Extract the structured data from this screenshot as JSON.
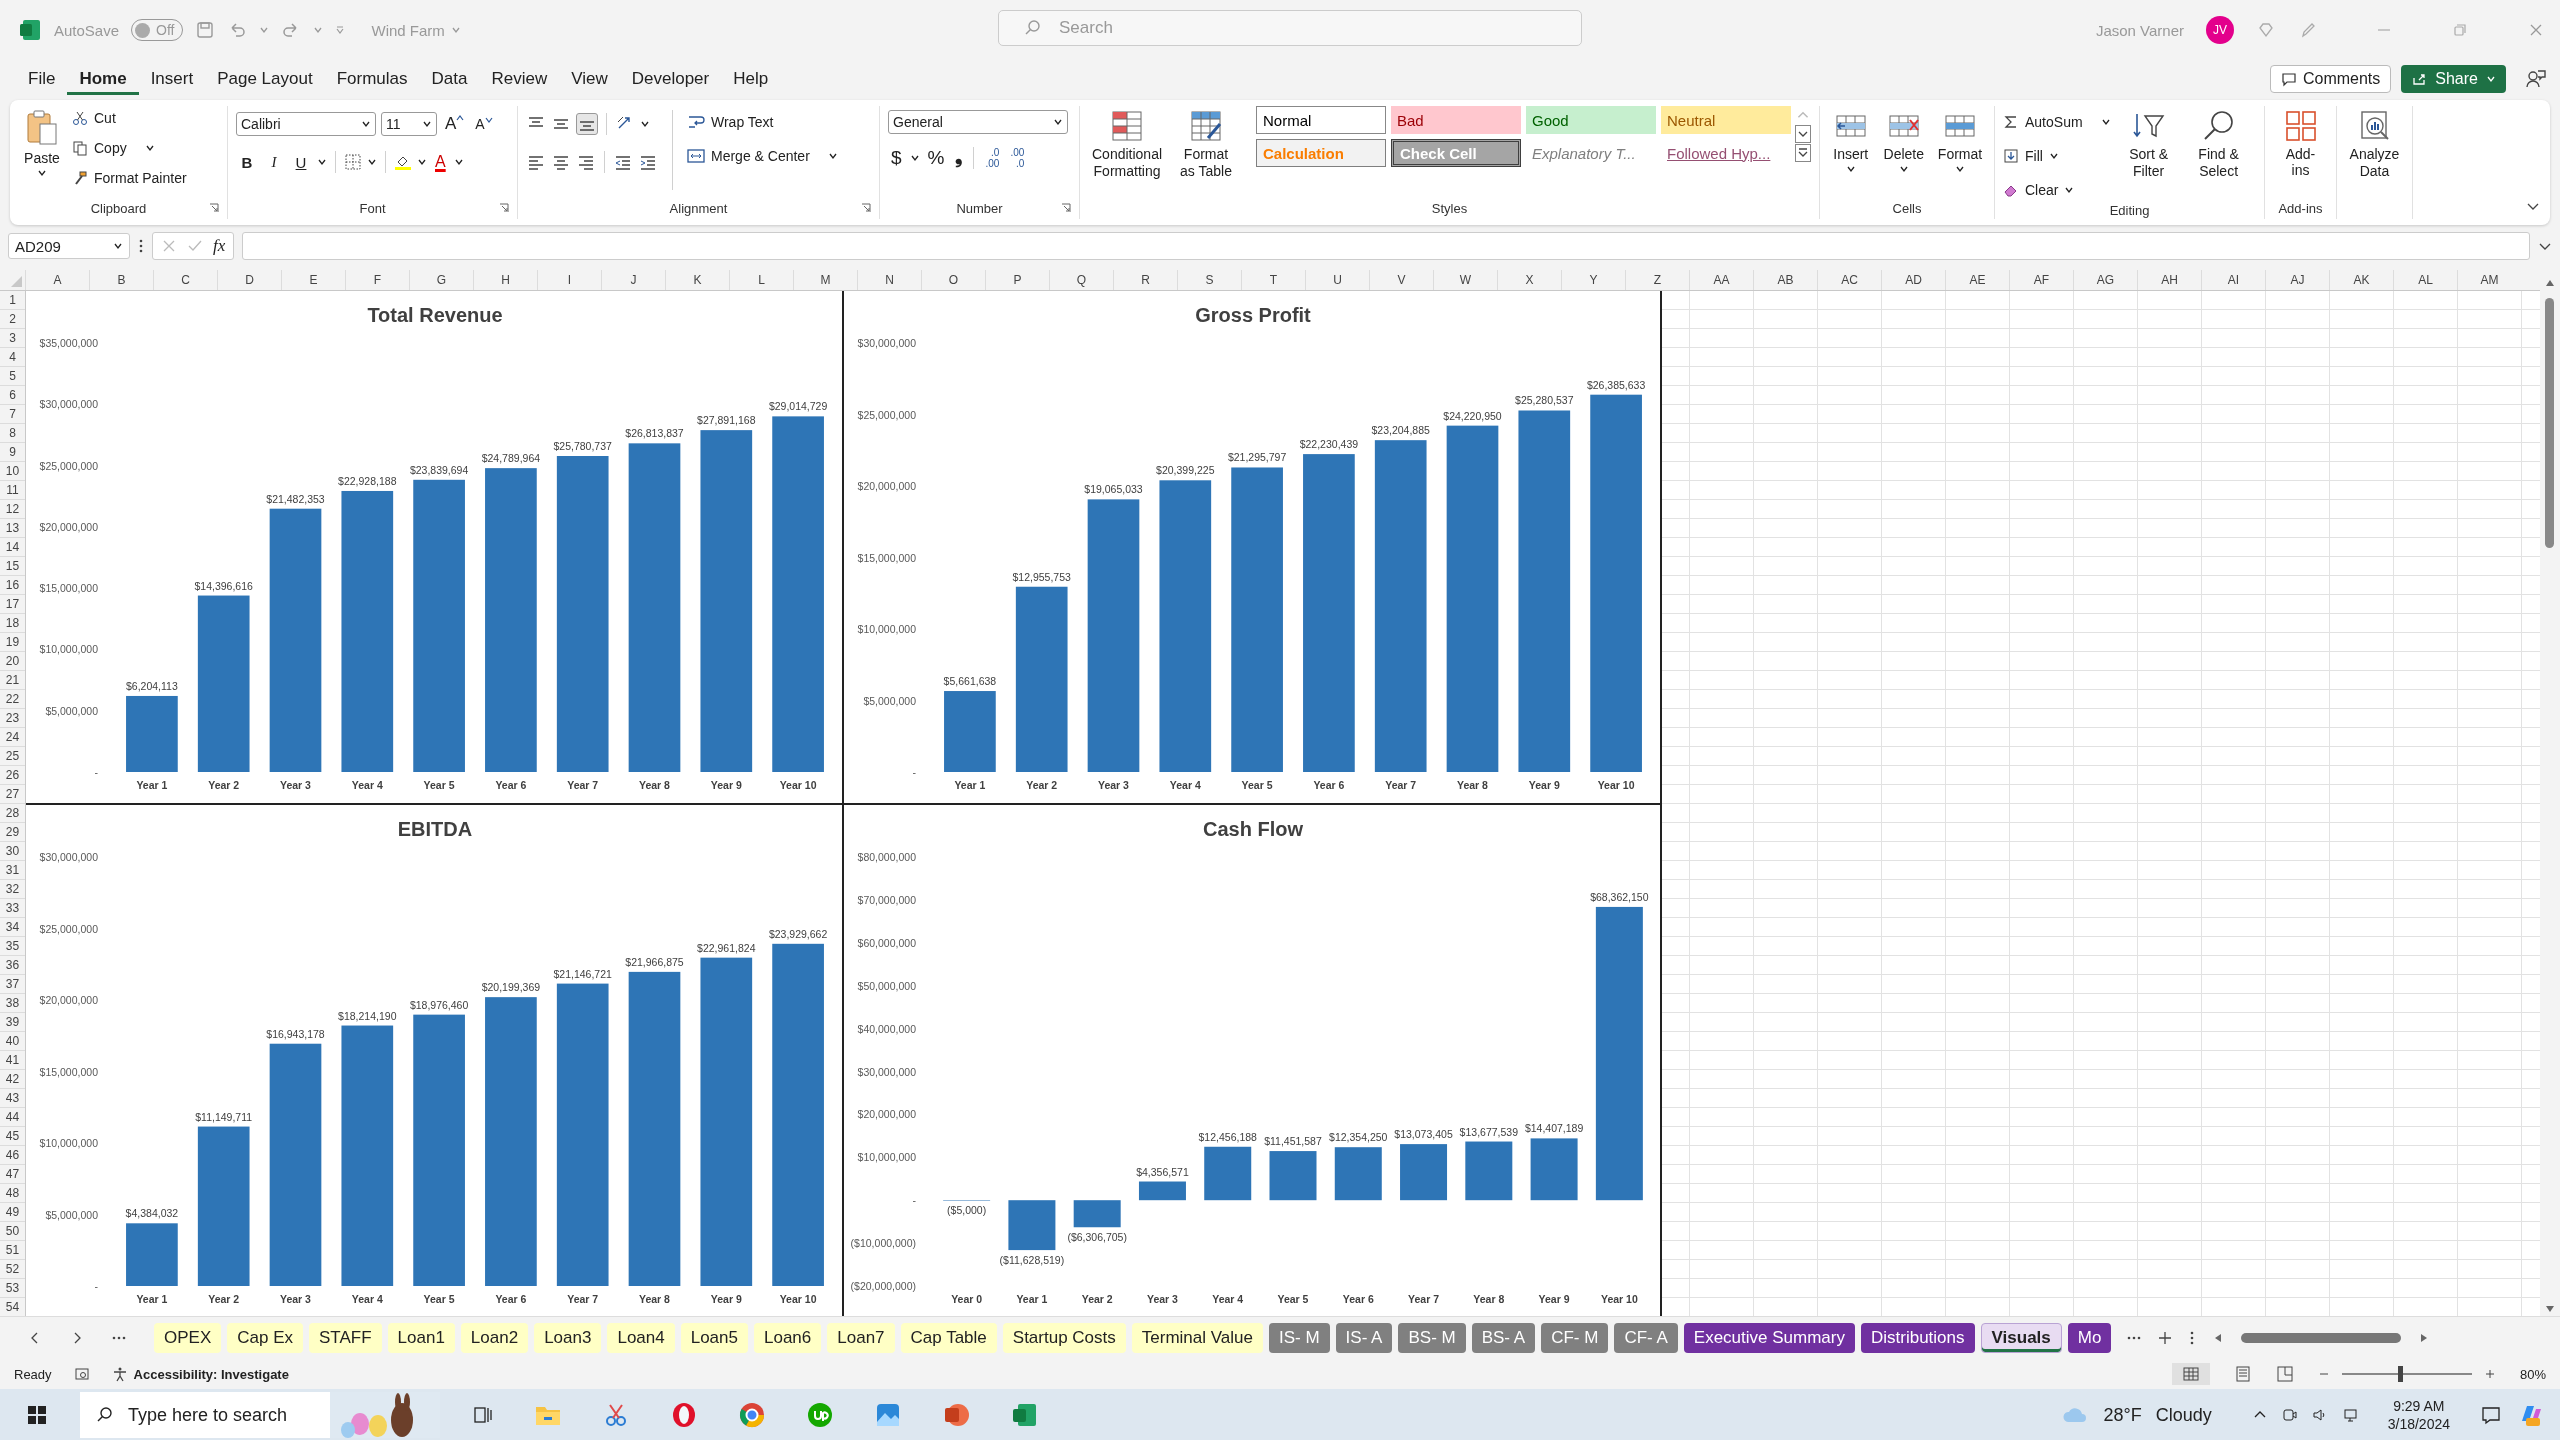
{
  "title_bar": {
    "autosave": "AutoSave",
    "autosave_state": "Off",
    "autosave_on": false,
    "file_name": "Wind Farm",
    "search_placeholder": "Search",
    "user_name": "Jason Varner",
    "avatar": "JV"
  },
  "menu_tabs": [
    {
      "label": "File",
      "selected": false
    },
    {
      "label": "Home",
      "selected": true
    },
    {
      "label": "Insert",
      "selected": false
    },
    {
      "label": "Page Layout",
      "selected": false
    },
    {
      "label": "Formulas",
      "selected": false
    },
    {
      "label": "Data",
      "selected": false
    },
    {
      "label": "Review",
      "selected": false
    },
    {
      "label": "View",
      "selected": false
    },
    {
      "label": "Developer",
      "selected": false
    },
    {
      "label": "Help",
      "selected": false
    }
  ],
  "comments": "Comments",
  "share": "Share",
  "clipboard": {
    "paste": "Paste",
    "cut": "Cut",
    "copy": "Copy",
    "format_painter": "Format Painter",
    "label": "Clipboard"
  },
  "font": {
    "name": "Calibri",
    "size": "11",
    "grow": "A",
    "shrink": "A",
    "format_buttons": [
      "B",
      "I",
      "U"
    ],
    "color_letter": "A",
    "label": "Font"
  },
  "alignment": {
    "wrap_text": "Wrap Text",
    "merge_center": "Merge & Center",
    "label": "Alignment"
  },
  "number": {
    "format": "General",
    "buttons": [
      "$",
      "%",
      "❟"
    ],
    "decimals": [
      [
        ".0",
        ".00"
      ],
      [
        ".00",
        ".0"
      ]
    ],
    "label": "Number"
  },
  "styles": {
    "conditional": "Conditional Formatting",
    "format_table": "Format as Table",
    "gallery": [
      {
        "label": "Normal",
        "kind": "normal"
      },
      {
        "label": "Bad",
        "kind": "bad"
      },
      {
        "label": "Good",
        "kind": "good"
      },
      {
        "label": "Neutral",
        "kind": "neutral"
      },
      {
        "label": "Calculation",
        "kind": "calculation"
      },
      {
        "label": "Check Cell",
        "kind": "check"
      },
      {
        "label": "Explanatory T...",
        "kind": "explanatory"
      },
      {
        "label": "Followed Hyp...",
        "kind": "followed"
      }
    ],
    "label": "Styles"
  },
  "cells": {
    "buttons": [
      "Insert",
      "Delete",
      "Format"
    ],
    "label": "Cells"
  },
  "editing": {
    "autosum": "AutoSum",
    "fill": "Fill",
    "clear": "Clear",
    "sort_filter": "Sort & Filter",
    "find_select": "Find & Select",
    "label": "Editing"
  },
  "addins": {
    "button": "Add-ins",
    "label": "Add-ins"
  },
  "analyze": {
    "button": "Analyze Data"
  },
  "formula_bar": {
    "name_box": "AD209",
    "fx": "fx"
  },
  "columns": [
    "A",
    "B",
    "C",
    "D",
    "E",
    "F",
    "G",
    "H",
    "I",
    "J",
    "K",
    "L",
    "M",
    "N",
    "O",
    "P",
    "Q",
    "R",
    "S",
    "T",
    "U",
    "V",
    "W",
    "X",
    "Y",
    "Z",
    "AA",
    "AB",
    "AC",
    "AD",
    "AE",
    "AF",
    "AG",
    "AH",
    "AI",
    "AJ",
    "AK",
    "AL",
    "AM"
  ],
  "rows": [
    "1",
    "2",
    "3",
    "4",
    "5",
    "6",
    "7",
    "8",
    "9",
    "10",
    "11",
    "12",
    "13",
    "14",
    "15",
    "16",
    "17",
    "18",
    "19",
    "20",
    "21",
    "22",
    "23",
    "24",
    "25",
    "26",
    "27",
    "28",
    "29",
    "30",
    "31",
    "32",
    "33",
    "34",
    "35",
    "36",
    "37",
    "38",
    "39",
    "40",
    "41",
    "42",
    "43",
    "44",
    "45",
    "46",
    "47",
    "48",
    "49",
    "50",
    "51",
    "52",
    "53",
    "54"
  ],
  "charts": [
    {
      "chart_data": {
        "type": "bar",
        "title": "Total Revenue",
        "categories": [
          "Year 1",
          "Year 2",
          "Year 3",
          "Year 4",
          "Year 5",
          "Year 6",
          "Year 7",
          "Year 8",
          "Year 9",
          "Year 10"
        ],
        "series": [
          {
            "color": "#2e75b6",
            "values": [
              6204113,
              14396616,
              21482353,
              22928188,
              23839694,
              24789964,
              25780737,
              26813837,
              27891168,
              29014729
            ]
          }
        ],
        "ylim": [
          0,
          35000000
        ],
        "yticks": [
          {
            "value": 0,
            "label": "-"
          },
          {
            "value": 5000000,
            "label": "$5,000,000"
          },
          {
            "value": 10000000,
            "label": "$10,000,000"
          },
          {
            "value": 15000000,
            "label": "$15,000,000"
          },
          {
            "value": 20000000,
            "label": "$20,000,000"
          },
          {
            "value": 25000000,
            "label": "$25,000,000"
          },
          {
            "value": 30000000,
            "label": "$30,000,000"
          },
          {
            "value": 35000000,
            "label": "$35,000,000"
          }
        ],
        "value_labels": [
          "$6,204,113",
          "$14,396,616",
          "$21,482,353",
          "$22,928,188",
          "$23,839,694",
          "$24,789,964",
          "$25,780,737",
          "$26,813,837",
          "$27,891,168",
          "$29,014,729"
        ]
      }
    },
    {
      "chart_data": {
        "type": "bar",
        "title": "Gross Profit",
        "categories": [
          "Year 1",
          "Year 2",
          "Year 3",
          "Year 4",
          "Year 5",
          "Year 6",
          "Year 7",
          "Year 8",
          "Year 9",
          "Year 10"
        ],
        "series": [
          {
            "color": "#2e75b6",
            "values": [
              5661638,
              12955753,
              19065033,
              20399225,
              21295797,
              22230439,
              23204885,
              24220950,
              25280537,
              26385633
            ]
          }
        ],
        "ylim": [
          0,
          30000000
        ],
        "yticks": [
          {
            "value": 0,
            "label": "-"
          },
          {
            "value": 5000000,
            "label": "$5,000,000"
          },
          {
            "value": 10000000,
            "label": "$10,000,000"
          },
          {
            "value": 15000000,
            "label": "$15,000,000"
          },
          {
            "value": 20000000,
            "label": "$20,000,000"
          },
          {
            "value": 25000000,
            "label": "$25,000,000"
          },
          {
            "value": 30000000,
            "label": "$30,000,000"
          }
        ],
        "value_labels": [
          "$5,661,638",
          "$12,955,753",
          "$19,065,033",
          "$20,399,225",
          "$21,295,797",
          "$22,230,439",
          "$23,204,885",
          "$24,220,950",
          "$25,280,537",
          "$26,385,633"
        ]
      }
    },
    {
      "chart_data": {
        "type": "bar",
        "title": "EBITDA",
        "categories": [
          "Year 1",
          "Year 2",
          "Year 3",
          "Year 4",
          "Year 5",
          "Year 6",
          "Year 7",
          "Year 8",
          "Year 9",
          "Year 10"
        ],
        "series": [
          {
            "color": "#2e75b6",
            "values": [
              4384032,
              11149711,
              16943178,
              18214190,
              18976460,
              20199369,
              21146721,
              21966875,
              22961824,
              23929662
            ]
          }
        ],
        "ylim": [
          0,
          30000000
        ],
        "yticks": [
          {
            "value": 0,
            "label": "-"
          },
          {
            "value": 5000000,
            "label": "$5,000,000"
          },
          {
            "value": 10000000,
            "label": "$10,000,000"
          },
          {
            "value": 15000000,
            "label": "$15,000,000"
          },
          {
            "value": 20000000,
            "label": "$20,000,000"
          },
          {
            "value": 25000000,
            "label": "$25,000,000"
          },
          {
            "value": 30000000,
            "label": "$30,000,000"
          }
        ],
        "value_labels": [
          "$4,384,032",
          "$11,149,711",
          "$16,943,178",
          "$18,214,190",
          "$18,976,460",
          "$20,199,369",
          "$21,146,721",
          "$21,966,875",
          "$22,961,824",
          "$23,929,662"
        ]
      }
    },
    {
      "chart_data": {
        "type": "bar",
        "title": "Cash Flow",
        "categories": [
          "Year 0",
          "Year 1",
          "Year 2",
          "Year 3",
          "Year 4",
          "Year 5",
          "Year 6",
          "Year 7",
          "Year 8",
          "Year 9",
          "Year 10"
        ],
        "series": [
          {
            "color": "#2e75b6",
            "values": [
              -5000,
              -11628519,
              -6306705,
              4356571,
              12456188,
              11451587,
              12354250,
              13073405,
              13677539,
              14407189,
              68362150
            ]
          }
        ],
        "ylim": [
          -20000000,
          80000000
        ],
        "yticks": [
          {
            "value": -20000000,
            "label": "($20,000,000)"
          },
          {
            "value": -10000000,
            "label": "($10,000,000)"
          },
          {
            "value": 0,
            "label": "-"
          },
          {
            "value": 10000000,
            "label": "$10,000,000"
          },
          {
            "value": 20000000,
            "label": "$20,000,000"
          },
          {
            "value": 30000000,
            "label": "$30,000,000"
          },
          {
            "value": 40000000,
            "label": "$40,000,000"
          },
          {
            "value": 50000000,
            "label": "$50,000,000"
          },
          {
            "value": 60000000,
            "label": "$60,000,000"
          },
          {
            "value": 70000000,
            "label": "$70,000,000"
          },
          {
            "value": 80000000,
            "label": "$80,000,000"
          }
        ],
        "value_labels": [
          "($5,000)",
          "($11,628,519)",
          "($6,306,705)",
          "$4,356,571",
          "$12,456,188",
          "$11,451,587",
          "$12,354,250",
          "$13,073,405",
          "$13,677,539",
          "$14,407,189",
          "$68,362,150"
        ]
      }
    }
  ],
  "sheet_tabs": [
    {
      "label": "OPEX",
      "color": "#ffffc5",
      "selected": false
    },
    {
      "label": "Cap Ex",
      "color": "#ffffc5",
      "selected": false
    },
    {
      "label": "STAFF",
      "color": "#ffffc5",
      "selected": false
    },
    {
      "label": "Loan1",
      "color": "#ffffc5",
      "selected": false
    },
    {
      "label": "Loan2",
      "color": "#ffffc5",
      "selected": false
    },
    {
      "label": "Loan3",
      "color": "#ffffc5",
      "selected": false
    },
    {
      "label": "Loan4",
      "color": "#ffffc5",
      "selected": false
    },
    {
      "label": "Loan5",
      "color": "#ffffc5",
      "selected": false
    },
    {
      "label": "Loan6",
      "color": "#ffffc5",
      "selected": false
    },
    {
      "label": "Loan7",
      "color": "#ffffc5",
      "selected": false
    },
    {
      "label": "Cap Table",
      "color": "#ffffc5",
      "selected": false
    },
    {
      "label": "Startup Costs",
      "color": "#ffffc5",
      "selected": false
    },
    {
      "label": "Terminal Value",
      "color": "#ffffc5",
      "selected": false
    },
    {
      "label": "IS- M",
      "color": "#808080",
      "selected": false
    },
    {
      "label": "IS- A",
      "color": "#808080",
      "selected": false
    },
    {
      "label": "BS- M",
      "color": "#808080",
      "selected": false
    },
    {
      "label": "BS- A",
      "color": "#808080",
      "selected": false
    },
    {
      "label": "CF- M",
      "color": "#808080",
      "selected": false
    },
    {
      "label": "CF- A",
      "color": "#808080",
      "selected": false
    },
    {
      "label": "Executive Summary",
      "color": "#7030a0",
      "selected": false
    },
    {
      "label": "Distributions",
      "color": "#7030a0",
      "selected": false
    },
    {
      "label": "Visuals",
      "color": "#e8dcf2",
      "selected": true
    },
    {
      "label": "Mo",
      "color": "#7030a0",
      "selected": false
    }
  ],
  "status_bar": {
    "ready": "Ready",
    "accessibility": "Accessibility: Investigate",
    "zoom": "80%",
    "zoom_slider": {
      "level": 0.45
    }
  },
  "taskbar": {
    "search_placeholder": "Type here to search",
    "temperature": "28°F",
    "weather": "Cloudy",
    "time": "9:29 AM",
    "date": "3/18/2024"
  }
}
